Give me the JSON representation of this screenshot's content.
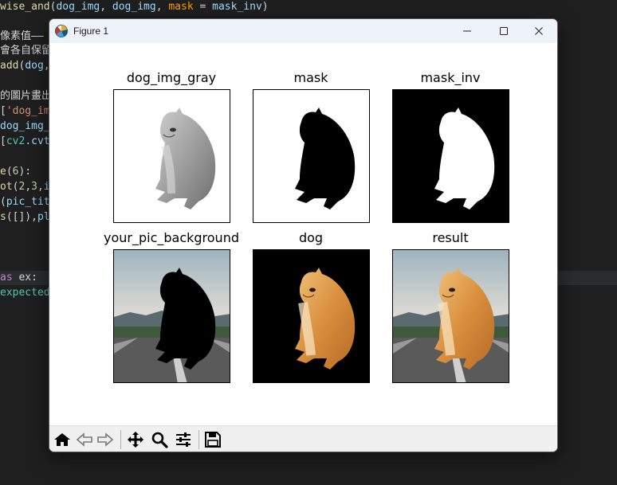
{
  "editor": {
    "lines": [
      {
        "id": "l1",
        "segments": [
          [
            "fn",
            "wise_and"
          ],
          [
            "plain",
            "("
          ],
          [
            "var",
            "dog_img"
          ],
          [
            "plain",
            ", "
          ],
          [
            "var",
            "dog_img"
          ],
          [
            "plain",
            ", "
          ],
          [
            "kwarg",
            "mask"
          ],
          [
            "plain",
            " = "
          ],
          [
            "var",
            "mask_inv"
          ],
          [
            "plain",
            ")"
          ]
        ]
      },
      {
        "id": "l2",
        "segments": [
          [
            "cmt",
            "像素值——"
          ]
        ]
      },
      {
        "id": "l3",
        "segments": [
          [
            "cmt",
            "會各自保留"
          ]
        ]
      },
      {
        "id": "l4",
        "segments": [
          [
            "fn",
            "add"
          ],
          [
            "plain",
            "("
          ],
          [
            "var",
            "dog"
          ],
          [
            "plain",
            ","
          ]
        ]
      },
      {
        "id": "l5",
        "segments": [
          [
            "cmt",
            "的圖片畫出"
          ]
        ]
      },
      {
        "id": "l6",
        "segments": [
          [
            "plain",
            "["
          ],
          [
            "str",
            "'dog_im"
          ]
        ]
      },
      {
        "id": "l7",
        "segments": [
          [
            "var",
            "dog_img_"
          ]
        ]
      },
      {
        "id": "l8",
        "segments": [
          [
            "plain",
            "["
          ],
          [
            "cls",
            "cv2"
          ],
          [
            "plain",
            "."
          ],
          [
            "var",
            "cvt"
          ]
        ]
      },
      {
        "id": "l9",
        "segments": [
          [
            "fn",
            "e"
          ],
          [
            "plain",
            "("
          ],
          [
            "num",
            "6"
          ],
          [
            "plain",
            "):"
          ]
        ]
      },
      {
        "id": "l10",
        "segments": [
          [
            "fn",
            "ot"
          ],
          [
            "plain",
            "("
          ],
          [
            "num",
            "2"
          ],
          [
            "plain",
            ","
          ],
          [
            "num",
            "3"
          ],
          [
            "plain",
            ","
          ],
          [
            "var",
            "i"
          ]
        ]
      },
      {
        "id": "l11",
        "segments": [
          [
            "plain",
            "("
          ],
          [
            "var",
            "pic_tit"
          ]
        ]
      },
      {
        "id": "l12",
        "segments": [
          [
            "fn",
            "s"
          ],
          [
            "plain",
            "([]),"
          ],
          [
            "var",
            "pl"
          ]
        ]
      },
      {
        "id": "l13",
        "segments": [
          [
            "kw",
            "as"
          ],
          [
            "plain",
            " ex:"
          ]
        ]
      },
      {
        "id": "l14",
        "segments": [
          [
            "cls",
            "expected"
          ]
        ]
      }
    ]
  },
  "window": {
    "title": "Figure 1",
    "icons": {
      "app": "matplotlib-icon",
      "minimize": "minimize-icon",
      "maximize": "maximize-icon",
      "close": "close-icon"
    }
  },
  "subplots": [
    {
      "title": "dog_img_gray",
      "kind": "gray"
    },
    {
      "title": "mask",
      "kind": "mask"
    },
    {
      "title": "mask_inv",
      "kind": "mask_inv"
    },
    {
      "title": "your_pic_background",
      "kind": "background"
    },
    {
      "title": "dog",
      "kind": "dog"
    },
    {
      "title": "result",
      "kind": "result"
    }
  ],
  "toolbar": {
    "buttons": [
      "home-icon",
      "back-icon",
      "forward-icon",
      "pan-icon",
      "zoom-icon",
      "configure-subplots-icon",
      "save-icon"
    ]
  }
}
